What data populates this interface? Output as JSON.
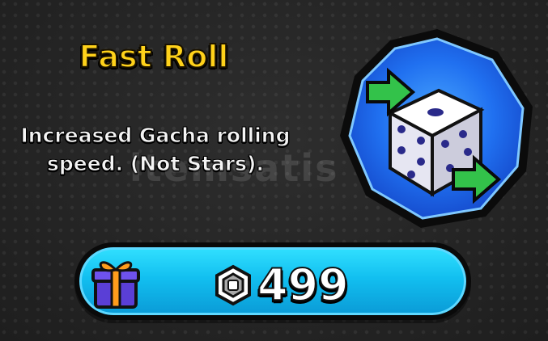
{
  "item": {
    "title": "Fast Roll",
    "description": "Increased Gacha rolling speed. (Not Stars).",
    "icon": "dice-with-arrows-icon"
  },
  "purchase": {
    "price": "499",
    "currency_icon": "robux-icon",
    "gift_icon": "gift-icon"
  },
  "watermark": "itemsatis",
  "colors": {
    "title": "#ffd21a",
    "button": "#12bff0",
    "badge": "#1a56e8"
  }
}
